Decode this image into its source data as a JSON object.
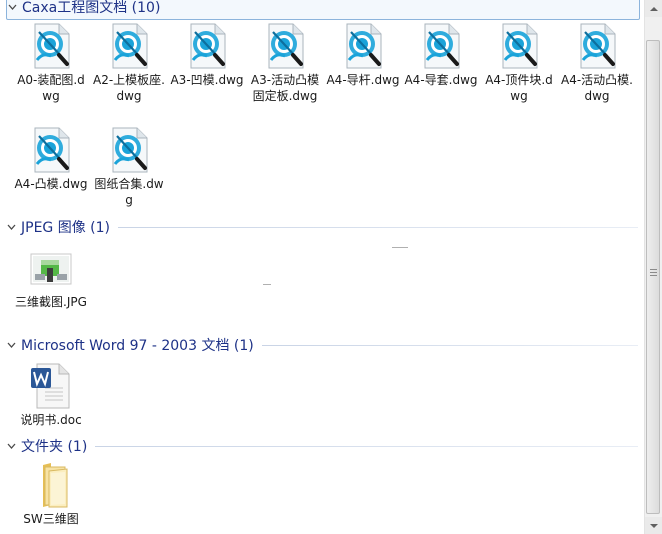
{
  "groups": [
    {
      "title": "Caxa工程图文档 (10)",
      "items": [
        {
          "label": "A0-装配图.dwg",
          "icon": "caxa-dwg-icon"
        },
        {
          "label": "A2-上模板座.dwg",
          "icon": "caxa-dwg-icon"
        },
        {
          "label": "A3-凹模.dwg",
          "icon": "caxa-dwg-icon"
        },
        {
          "label": "A3-活动凸模固定板.dwg",
          "icon": "caxa-dwg-icon"
        },
        {
          "label": "A4-导杆.dwg",
          "icon": "caxa-dwg-icon"
        },
        {
          "label": "A4-导套.dwg",
          "icon": "caxa-dwg-icon"
        },
        {
          "label": "A4-顶件块.dwg",
          "icon": "caxa-dwg-icon"
        },
        {
          "label": "A4-活动凸模.dwg",
          "icon": "caxa-dwg-icon"
        },
        {
          "label": "A4-凸模.dwg",
          "icon": "caxa-dwg-icon"
        },
        {
          "label": "图纸合集.dwg",
          "icon": "caxa-dwg-icon"
        }
      ]
    },
    {
      "title": "JPEG 图像 (1)",
      "items": [
        {
          "label": "三维截图.JPG",
          "icon": "jpg-image-icon"
        }
      ]
    },
    {
      "title": "Microsoft Word 97 - 2003 文档 (1)",
      "items": [
        {
          "label": "说明书.doc",
          "icon": "word-doc-icon"
        }
      ]
    },
    {
      "title": "文件夹 (1)",
      "items": [
        {
          "label": "SW三维图",
          "icon": "folder-icon"
        }
      ]
    }
  ],
  "colors": {
    "group_title": "#1e3287",
    "caxa_icon": "#1aa3d9",
    "word_blue": "#2b5797",
    "folder": "#f2d27a"
  }
}
